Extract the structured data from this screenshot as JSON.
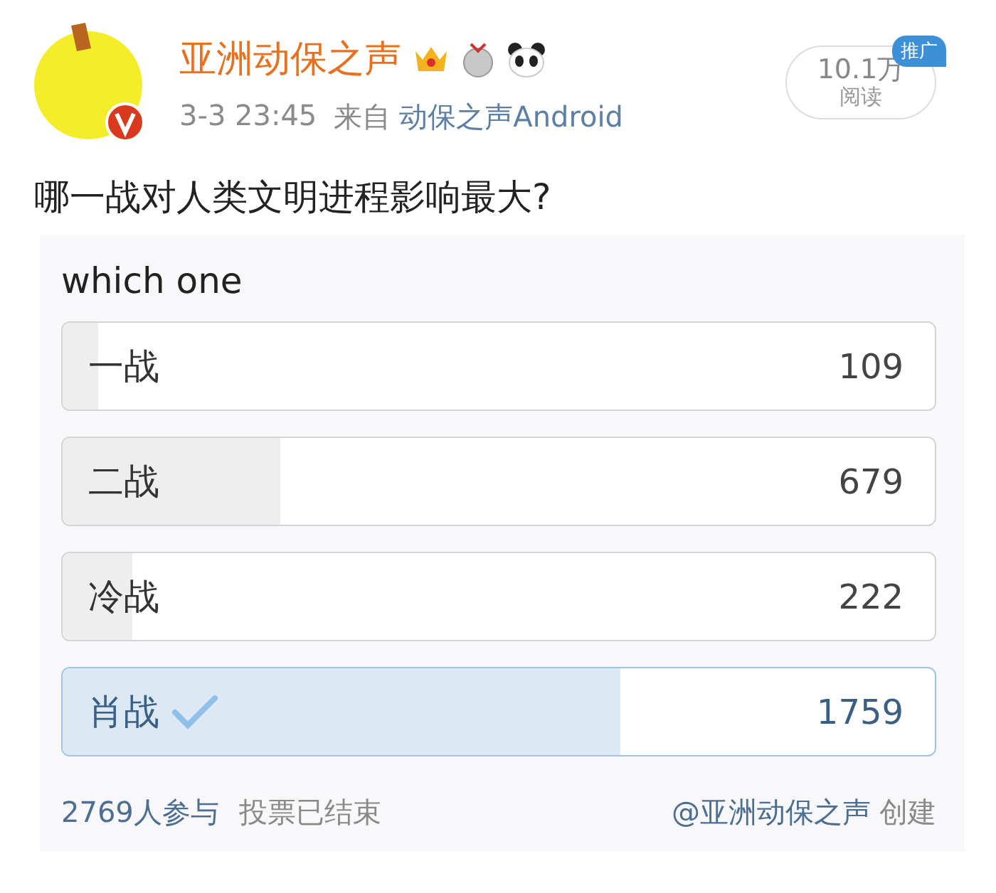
{
  "post": {
    "author": "亚洲动保之声",
    "time": "3-3 23:45",
    "source_prefix": "来自",
    "source": "动保之声Android",
    "views": "10.1万",
    "views_label": "阅读",
    "promo_badge": "推广",
    "text": "哪一战对人类文明进程影响最大?"
  },
  "poll": {
    "title": "which one",
    "options": [
      {
        "label": "一战",
        "count": "109",
        "level": 0.04,
        "selected": false
      },
      {
        "label": "二战",
        "count": "679",
        "level": 0.25,
        "selected": false
      },
      {
        "label": "冷战",
        "count": "222",
        "level": 0.08,
        "selected": false
      },
      {
        "label": "肖战",
        "count": "1759",
        "level": 0.64,
        "selected": true
      }
    ],
    "participants": "2769人参与",
    "status": "投票已结束",
    "creator": "@亚洲动保之声",
    "created_label": "创建"
  }
}
